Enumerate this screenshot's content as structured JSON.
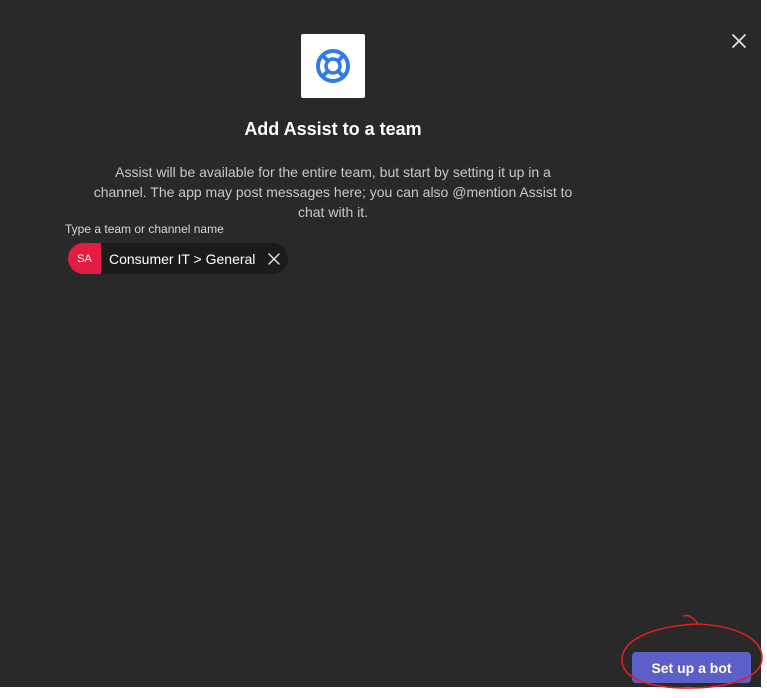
{
  "dialog": {
    "title": "Add Assist to a team",
    "description": "Assist will be available for the entire team, but start by setting it up in a channel. The app may post messages here; you can also @mention Assist to chat with it.",
    "close_icon": "close-icon",
    "app_icon": "lifebuoy-icon",
    "app_icon_color": "#2f7be8"
  },
  "picker": {
    "label": "Type a team or channel name",
    "selected": {
      "avatar_initials": "SA",
      "avatar_color": "#e41c43",
      "text": "Consumer IT > General",
      "remove_icon": "close-icon"
    }
  },
  "footer": {
    "primary_label": "Set up a bot",
    "primary_color": "#5b5fc7",
    "annotation_color": "#e01f1f"
  }
}
